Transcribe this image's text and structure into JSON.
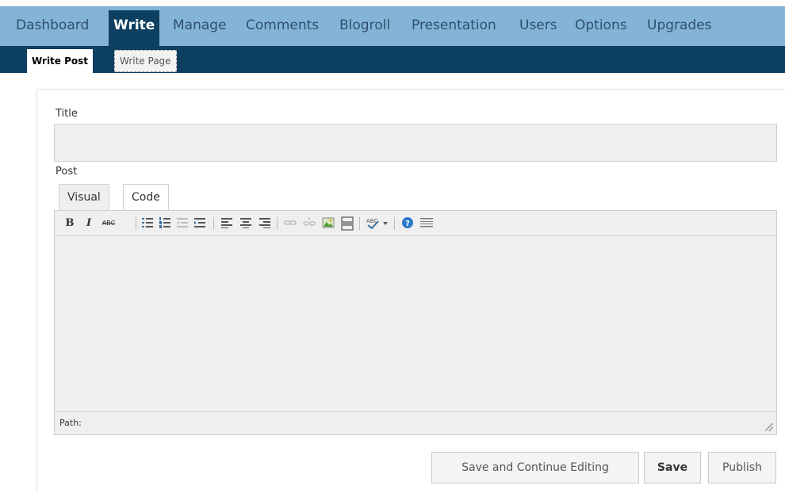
{
  "admin_menu": {
    "items": [
      {
        "label": "Dashboard",
        "active": false
      },
      {
        "label": "Write",
        "active": true
      },
      {
        "label": "Manage",
        "active": false
      },
      {
        "label": "Comments",
        "active": false
      },
      {
        "label": "Blogroll",
        "active": false
      },
      {
        "label": "Presentation",
        "active": false
      },
      {
        "label": "Users",
        "active": false
      },
      {
        "label": "Options",
        "active": false
      },
      {
        "label": "Upgrades",
        "active": false
      }
    ]
  },
  "sub_menu": {
    "items": [
      {
        "label": "Write Post",
        "active": true
      },
      {
        "label": "Write Page",
        "active": false
      }
    ]
  },
  "form": {
    "title_label": "Title",
    "title_value": "",
    "post_label": "Post",
    "tabs": [
      {
        "label": "Visual",
        "active": true
      },
      {
        "label": "Code",
        "active": false
      }
    ],
    "toolbar": {
      "bold": "B",
      "italic": "I",
      "strike": "ABC",
      "icons": [
        "bold-icon",
        "italic-icon",
        "strikethrough-icon",
        "bulleted-list-icon",
        "numbered-list-icon",
        "outdent-icon",
        "indent-icon",
        "align-left-icon",
        "align-center-icon",
        "align-right-icon",
        "link-icon",
        "unlink-icon",
        "image-icon",
        "page-break-icon",
        "spellcheck-icon",
        "help-icon",
        "more-icon"
      ]
    },
    "path_label": "Path:"
  },
  "actions": {
    "save_continue": "Save and Continue Editing",
    "save": "Save",
    "publish": "Publish"
  },
  "colors": {
    "menu_bar": "#83b4d8",
    "menu_active": "#0d3f61",
    "editor_bg": "#efefef"
  }
}
